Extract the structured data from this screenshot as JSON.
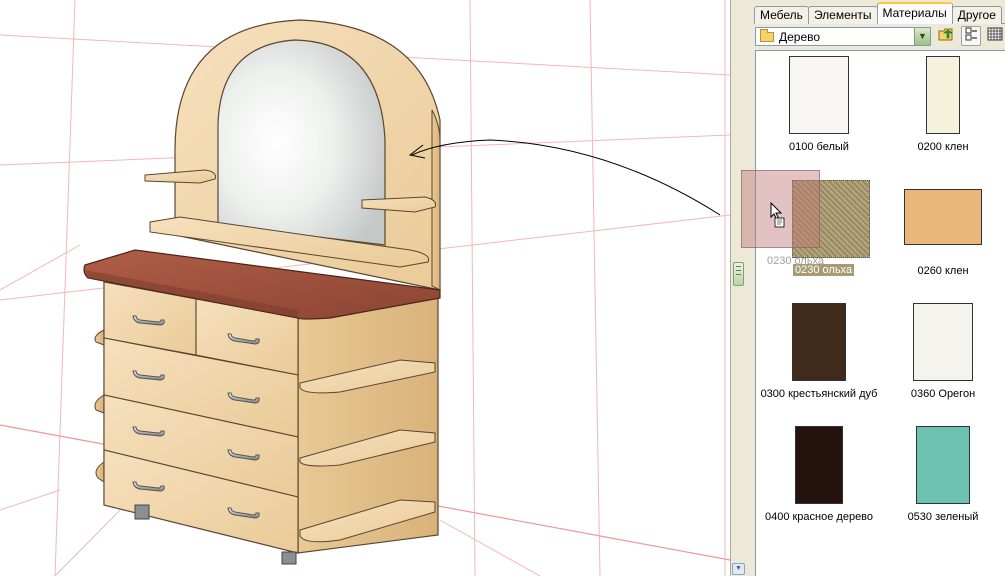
{
  "panel": {
    "tabs": [
      {
        "label": "Мебель",
        "active": false
      },
      {
        "label": "Элементы",
        "active": false
      },
      {
        "label": "Материалы",
        "active": true
      },
      {
        "label": "Другое",
        "active": false
      }
    ],
    "folder": {
      "value": "Дерево",
      "icon": "folder-icon"
    },
    "toolbar": {
      "up_icon": "folder-up-icon",
      "list_icon": "list-view-icon",
      "grid_icon": "grid-view-icon"
    },
    "materials": [
      {
        "label": "0100 белый",
        "color": "#f7f6f2",
        "state": "normal"
      },
      {
        "label": "0200 клен",
        "color": "#f4f1dc",
        "state": "normal"
      },
      {
        "label": "0230 ольха",
        "color": "#a89a72",
        "state": "selected"
      },
      {
        "label": "0260 клен",
        "color": "#e9b779",
        "state": "normal"
      },
      {
        "label": "0300 крестьянский дуб",
        "color": "#3f2a1c",
        "state": "normal"
      },
      {
        "label": "0360 Орегон",
        "color": "#f4f3ee",
        "state": "normal"
      },
      {
        "label": "0400 красное дерево",
        "color": "#26130f",
        "state": "normal"
      },
      {
        "label": "0530 зеленый",
        "color": "#6cc2b0",
        "state": "normal"
      }
    ]
  },
  "drag": {
    "ghost_label": "0230 ольха",
    "color": "#be7878"
  },
  "colors": {
    "body": "#f2d9b0",
    "top": "#9a4f3c",
    "accent": "#ffc83c"
  }
}
